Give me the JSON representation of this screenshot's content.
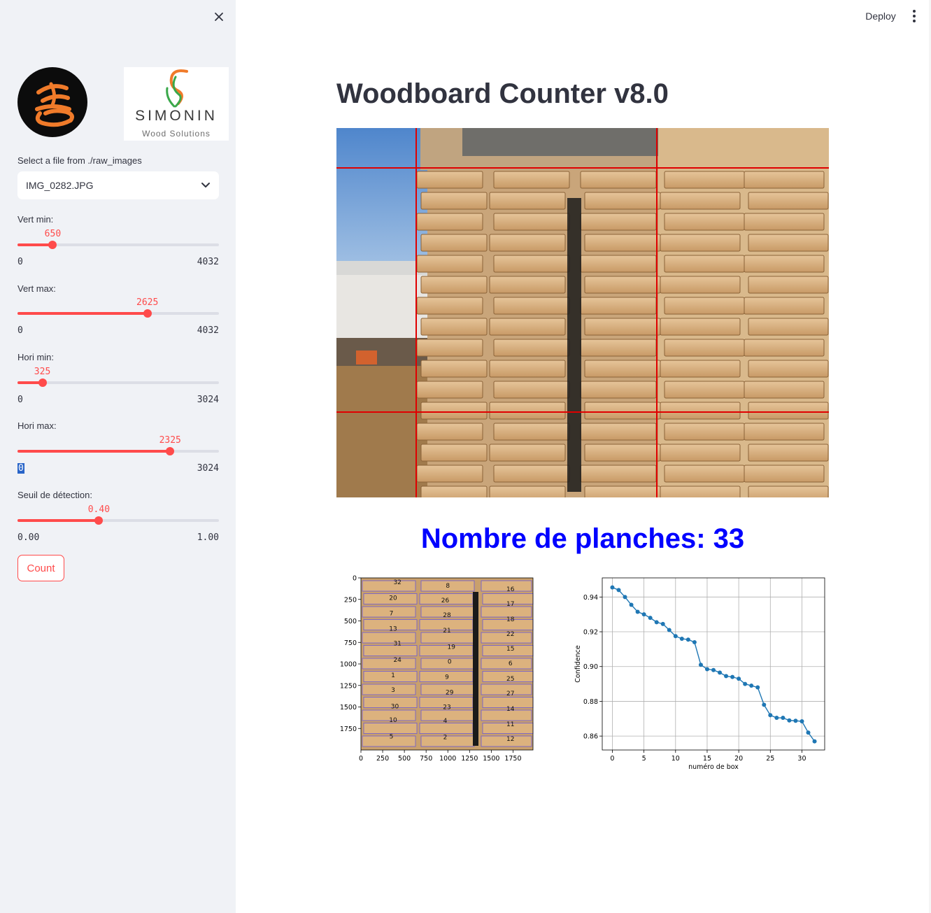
{
  "sidebar": {
    "file_select_label": "Select a file from ./raw_images",
    "file_selected": "IMG_0282.JPG",
    "logo_brand": "SIMONIN",
    "logo_sub": "Wood Solutions",
    "sliders": [
      {
        "label": "Vert min:",
        "value": "650",
        "min": "0",
        "max": "4032",
        "fraction": 0.161
      },
      {
        "label": "Vert max:",
        "value": "2625",
        "min": "0",
        "max": "4032",
        "fraction": 0.651
      },
      {
        "label": "Hori min:",
        "value": "325",
        "min": "0",
        "max": "3024",
        "fraction": 0.107
      },
      {
        "label": "Hori max:",
        "value": "2325",
        "min": "0",
        "max": "3024",
        "fraction": 0.769
      },
      {
        "label": "Seuil de détection:",
        "value": "0.40",
        "min": "0.00",
        "max": "1.00",
        "fraction": 0.4
      }
    ],
    "count_button": "Count"
  },
  "header": {
    "deploy": "Deploy"
  },
  "main": {
    "title": "Woodboard Counter v8.0",
    "count_heading": "Nombre de planches: 33"
  },
  "colors": {
    "accent": "#ff4b4b",
    "heading_blue": "#0000ff",
    "plot_line": "#1f77b4",
    "sidebar_bg": "#f0f2f6"
  },
  "chart_data": [
    {
      "type": "scatter",
      "x_ticks": [
        "0",
        "250",
        "500",
        "750",
        "1000",
        "1250",
        "1500",
        "1750"
      ],
      "y_ticks": [
        "0",
        "250",
        "500",
        "750",
        "1000",
        "1250",
        "1500",
        "1750"
      ],
      "xlim": [
        0,
        1980
      ],
      "ylim": [
        2000,
        0
      ],
      "box_labels": [
        {
          "id": "32",
          "x": 420,
          "y": 50
        },
        {
          "id": "8",
          "x": 1000,
          "y": 90
        },
        {
          "id": "16",
          "x": 1720,
          "y": 130
        },
        {
          "id": "20",
          "x": 370,
          "y": 230
        },
        {
          "id": "26",
          "x": 970,
          "y": 260
        },
        {
          "id": "17",
          "x": 1720,
          "y": 300
        },
        {
          "id": "7",
          "x": 350,
          "y": 410
        },
        {
          "id": "28",
          "x": 990,
          "y": 430
        },
        {
          "id": "18",
          "x": 1720,
          "y": 480
        },
        {
          "id": "13",
          "x": 370,
          "y": 590
        },
        {
          "id": "21",
          "x": 990,
          "y": 610
        },
        {
          "id": "22",
          "x": 1720,
          "y": 650
        },
        {
          "id": "31",
          "x": 420,
          "y": 760
        },
        {
          "id": "19",
          "x": 1040,
          "y": 800
        },
        {
          "id": "15",
          "x": 1720,
          "y": 820
        },
        {
          "id": "24",
          "x": 420,
          "y": 950
        },
        {
          "id": "0",
          "x": 1020,
          "y": 970
        },
        {
          "id": "6",
          "x": 1720,
          "y": 990
        },
        {
          "id": "1",
          "x": 370,
          "y": 1130
        },
        {
          "id": "9",
          "x": 990,
          "y": 1150
        },
        {
          "id": "25",
          "x": 1720,
          "y": 1170
        },
        {
          "id": "3",
          "x": 370,
          "y": 1300
        },
        {
          "id": "29",
          "x": 1020,
          "y": 1330
        },
        {
          "id": "27",
          "x": 1720,
          "y": 1340
        },
        {
          "id": "30",
          "x": 390,
          "y": 1490
        },
        {
          "id": "23",
          "x": 990,
          "y": 1500
        },
        {
          "id": "14",
          "x": 1720,
          "y": 1520
        },
        {
          "id": "10",
          "x": 370,
          "y": 1650
        },
        {
          "id": "4",
          "x": 970,
          "y": 1660
        },
        {
          "id": "11",
          "x": 1720,
          "y": 1700
        },
        {
          "id": "5",
          "x": 350,
          "y": 1840
        },
        {
          "id": "2",
          "x": 970,
          "y": 1850
        },
        {
          "id": "12",
          "x": 1720,
          "y": 1870
        }
      ]
    },
    {
      "type": "line",
      "xlabel": "numéro de box",
      "ylabel": "Confidence",
      "x_ticks": [
        0,
        5,
        10,
        15,
        20,
        25,
        30
      ],
      "y_ticks": [
        "0.86",
        "0.88",
        "0.90",
        "0.92",
        "0.94"
      ],
      "xlim": [
        -1.6,
        33.6
      ],
      "ylim": [
        0.852,
        0.951
      ],
      "grid": true,
      "x": [
        0,
        1,
        2,
        3,
        4,
        5,
        6,
        7,
        8,
        9,
        10,
        11,
        12,
        13,
        14,
        15,
        16,
        17,
        18,
        19,
        20,
        21,
        22,
        23,
        24,
        25,
        26,
        27,
        28,
        29,
        30,
        31,
        32
      ],
      "values": [
        0.9455,
        0.944,
        0.94,
        0.9355,
        0.9315,
        0.93,
        0.928,
        0.9255,
        0.9245,
        0.921,
        0.9175,
        0.916,
        0.9155,
        0.914,
        0.901,
        0.8985,
        0.898,
        0.8965,
        0.8945,
        0.894,
        0.893,
        0.89,
        0.889,
        0.888,
        0.878,
        0.872,
        0.8705,
        0.8705,
        0.869,
        0.8688,
        0.8685,
        0.862,
        0.857
      ]
    }
  ]
}
